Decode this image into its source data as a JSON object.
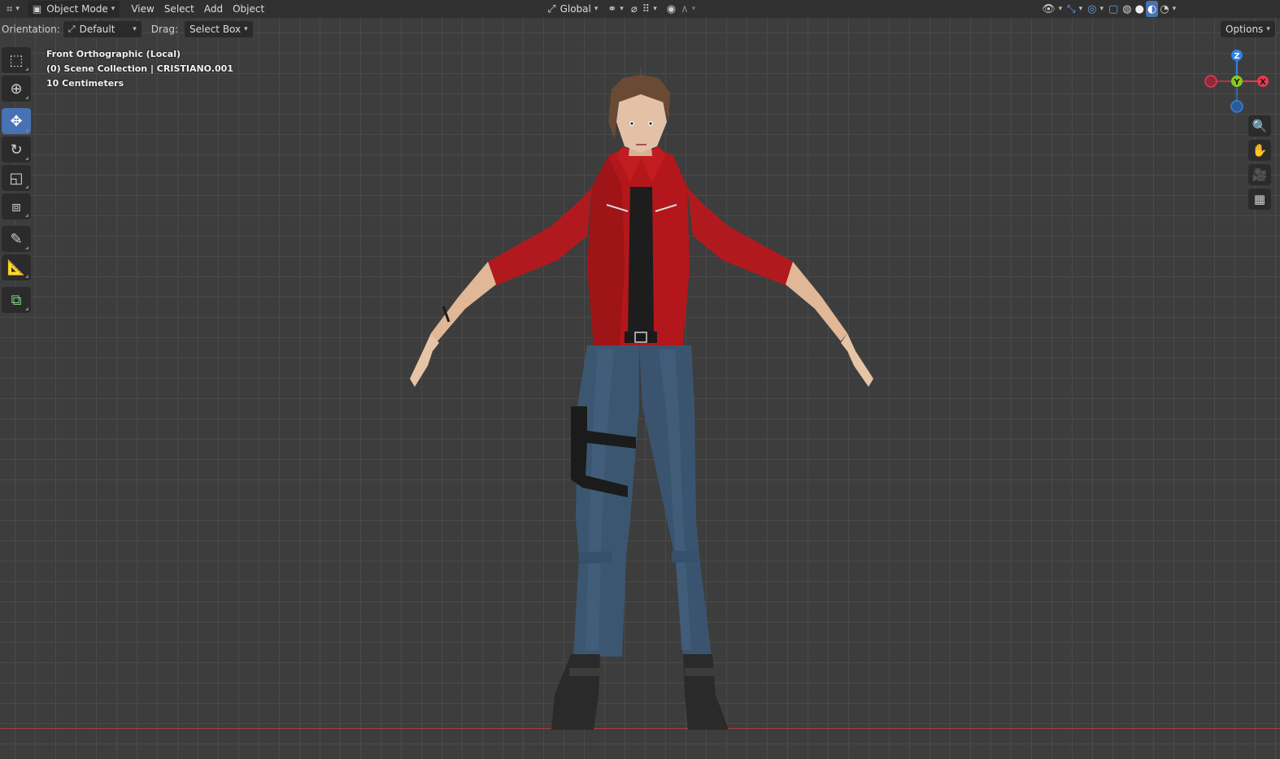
{
  "header": {
    "editor_type_icon": "editor-type-icon",
    "mode": "Object Mode",
    "menus": [
      "View",
      "Select",
      "Add",
      "Object"
    ],
    "transform_orientation": "Global",
    "icons_center": [
      "pivot-icon",
      "snap-icon",
      "snap-grid-icon",
      "proportional-edit-icon",
      "falloff-icon"
    ],
    "icons_right": [
      "visibility-icon",
      "gizmo-icon",
      "overlay-icon",
      "xray-icon",
      "wireframe-shading-icon",
      "solid-shading-icon",
      "material-shading-icon",
      "rendered-shading-icon"
    ]
  },
  "tool_settings": {
    "orientation_label": "Orientation:",
    "orientation_value": "Default",
    "drag_label": "Drag:",
    "drag_value": "Select Box",
    "options_label": "Options"
  },
  "tools": [
    {
      "name": "select-box",
      "icon": "select-box-icon",
      "active": false
    },
    {
      "name": "cursor",
      "icon": "cursor-icon",
      "active": false
    },
    {
      "name": "move",
      "icon": "move-icon",
      "active": true
    },
    {
      "name": "rotate",
      "icon": "rotate-icon",
      "active": false
    },
    {
      "name": "scale",
      "icon": "scale-icon",
      "active": false
    },
    {
      "name": "transform",
      "icon": "transform-icon",
      "active": false
    },
    {
      "name": "annotate",
      "icon": "annotate-icon",
      "active": false
    },
    {
      "name": "measure",
      "icon": "measure-icon",
      "active": false
    },
    {
      "name": "add-cube",
      "icon": "add-cube-icon",
      "active": false
    }
  ],
  "viewport": {
    "view_name": "Front Orthographic (Local)",
    "collection": "(0) Scene Collection | CRISTIANO.001",
    "scale": "10 Centimeters"
  },
  "gizmo": {
    "z_label": "Z",
    "y_label": "Y",
    "x_label": "X",
    "colors": {
      "x": "#e8394f",
      "y": "#8ac920",
      "z": "#2f83e6"
    }
  },
  "nav_buttons": [
    "zoom-icon",
    "pan-hand-icon",
    "camera-icon",
    "ortho-grid-icon"
  ]
}
